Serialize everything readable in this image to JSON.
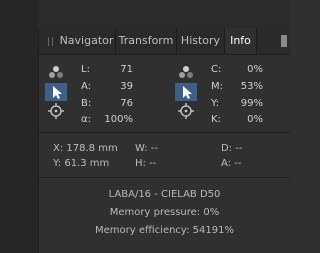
{
  "tabs": [
    {
      "label": "Navigator",
      "active": false
    },
    {
      "label": "Transform",
      "active": false
    },
    {
      "label": "History",
      "active": false
    },
    {
      "label": "Info",
      "active": true
    }
  ],
  "left_readout": {
    "rows": [
      {
        "label": "L:",
        "value": "71"
      },
      {
        "label": "A:",
        "value": "39"
      },
      {
        "label": "B:",
        "value": "76"
      },
      {
        "label": "α:",
        "value": "100%"
      }
    ]
  },
  "right_readout": {
    "rows": [
      {
        "label": "C:",
        "value": "0%"
      },
      {
        "label": "M:",
        "value": "53%"
      },
      {
        "label": "Y:",
        "value": "99%"
      },
      {
        "label": "K:",
        "value": "0%"
      }
    ]
  },
  "position": {
    "x": "X: 178.8 mm",
    "y": "Y: 61.3 mm",
    "w": "W: --",
    "h": "H: --",
    "d": "D: --",
    "a": "A: --"
  },
  "document_info": {
    "color_format": "LABA/16 - CIELAB D50",
    "memory_pressure": "Memory pressure: 0%",
    "memory_efficiency": "Memory efficiency: 54191%"
  },
  "colors": {
    "accent": "#3f5f87",
    "panel_bg": "#303030",
    "tab_bar_bg": "#2a2a2a"
  }
}
